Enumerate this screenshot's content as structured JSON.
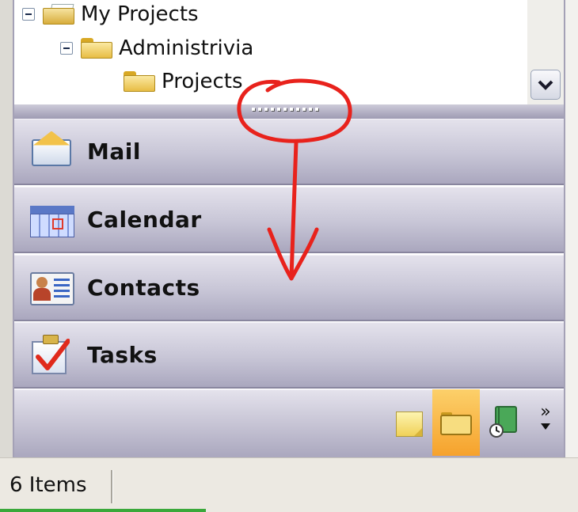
{
  "folder_tree": {
    "items": [
      {
        "label": "My Projects",
        "level": 0,
        "expanded": true
      },
      {
        "label": "Administrivia",
        "level": 1,
        "expanded": true
      },
      {
        "label": "Projects",
        "level": 2,
        "expanded": false
      }
    ]
  },
  "navigation": {
    "buttons": [
      {
        "label": "Mail",
        "icon": "mail-icon"
      },
      {
        "label": "Calendar",
        "icon": "calendar-icon"
      },
      {
        "label": "Contacts",
        "icon": "contacts-icon"
      },
      {
        "label": "Tasks",
        "icon": "tasks-icon"
      }
    ],
    "more_glyph": "»"
  },
  "shortcut_bar": {
    "icons": [
      "notes-icon",
      "folder-list-icon",
      "journal-icon",
      "configure-buttons-icon"
    ],
    "highlighted": "folder-list-icon"
  },
  "status_bar": {
    "item_count": "6 Items"
  },
  "colors": {
    "nav_button_top": "#e4e2ec",
    "nav_button_bottom": "#aaa7be",
    "highlight": "#f6a22c",
    "annotation": "#e8221c",
    "status_strip": "#3aa83a"
  }
}
